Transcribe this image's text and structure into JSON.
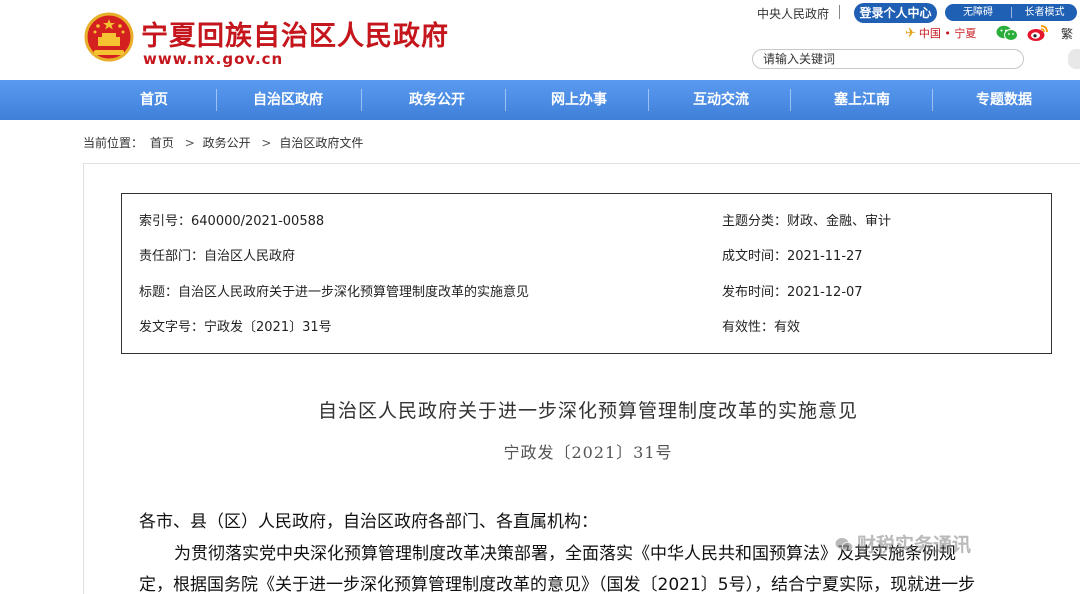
{
  "header": {
    "site_title": "宁夏回族自治区人民政府",
    "site_url": "www.nx.gov.cn",
    "central_gov_link": "中央人民政府",
    "login_label": "登录个人中心",
    "accessibility_label": "无障碍",
    "elderly_mode_label": "长者模式",
    "china_logo_label": "中国 • 宁夏",
    "traditional_label": "繁",
    "search_placeholder": "请输入关键词"
  },
  "nav": {
    "items": [
      "首页",
      "自治区政府",
      "政务公开",
      "网上办事",
      "互动交流",
      "塞上江南",
      "专题数据"
    ]
  },
  "breadcrumb": {
    "prefix": "当前位置：",
    "items": [
      "首页",
      "政务公开",
      "自治区政府文件"
    ],
    "separator": ">"
  },
  "meta": {
    "index_no": "索引号：640000/2021-00588",
    "department": "责任部门：自治区人民政府",
    "title": "标题：自治区人民政府关于进一步深化预算管理制度改革的实施意见",
    "doc_no": "发文字号：宁政发〔2021〕31号",
    "topic": "主题分类：财政、金融、审计",
    "created": "成文时间：2021-11-27",
    "published": "发布时间：2021-12-07",
    "validity": "有效性：有效"
  },
  "document": {
    "title": "自治区人民政府关于进一步深化预算管理制度改革的实施意见",
    "number": "宁政发〔2021〕31号",
    "salutation": "各市、县（区）人民政府，自治区政府各部门、各直属机构：",
    "paragraph_line1": "为贯彻落实党中央深化预算管理制度改革决策部署，全面落实《中华人民共和国预算法》及其实施条例规",
    "paragraph_line2": "定，根据国务院《关于进一步深化预算管理制度改革的意见》（国发〔2021〕5号），结合宁夏实际，现就进一步"
  },
  "watermark": {
    "text": "财税实务通讯"
  },
  "colors": {
    "brand_red": "#c4161c",
    "nav_blue": "#4d8fe8",
    "button_blue": "#1f5fb4"
  }
}
